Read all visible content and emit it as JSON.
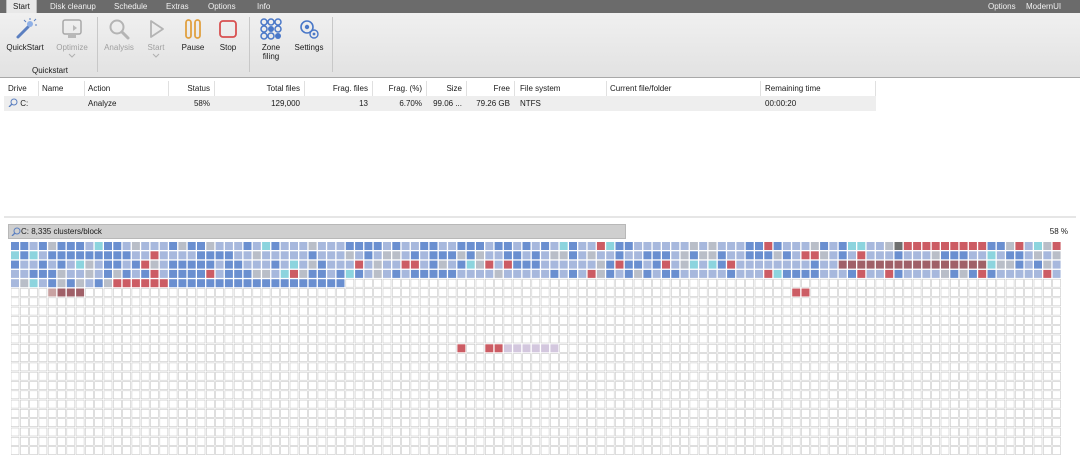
{
  "tabs": [
    "Start",
    "Disk cleanup",
    "Schedule",
    "Extras",
    "Options",
    "Info"
  ],
  "right_links": [
    "Options",
    "ModernUI"
  ],
  "ribbon": {
    "quickstart_label": "QuickStart",
    "optimize_label": "Optimize",
    "group_label": "Quickstart",
    "analysis_label": "Analysis",
    "start_label": "Start",
    "pause_label": "Pause",
    "stop_label": "Stop",
    "zone_filing_label": "Zone filing",
    "zone_line1": "Zone",
    "zone_line2": "filing",
    "settings_label": "Settings"
  },
  "table": {
    "headers": [
      "Drive",
      "Name",
      "Action",
      "Status",
      "Total files",
      "Frag. files",
      "Frag. (%)",
      "Size",
      "Free",
      "File system",
      "Current file/folder",
      "Remaining time"
    ],
    "row": {
      "drive": "C:",
      "name": "",
      "action": "Analyze",
      "status": "58%",
      "total_files": "129,000",
      "frag_files": "13",
      "frag_pct": "6.70%",
      "size": "99.06 ...",
      "free": "79.26 GB",
      "file_system": "NTFS",
      "current": "",
      "remaining": "00:00:20"
    }
  },
  "map": {
    "caption": "C: 8,335 clusters/block",
    "percent": "58 %",
    "progress": 0.58,
    "colors": {
      "empty": "#ffffff",
      "blue": "#6a8fd0",
      "light_blue": "#a7b8dd",
      "red": "#cc5c64",
      "gray": "#b9bec8",
      "cyan": "#8cd4de",
      "pink": "#c9a2a2",
      "brown": "#a06068",
      "lavender": "#d3c7de",
      "dark": "#6f6f6f"
    }
  }
}
